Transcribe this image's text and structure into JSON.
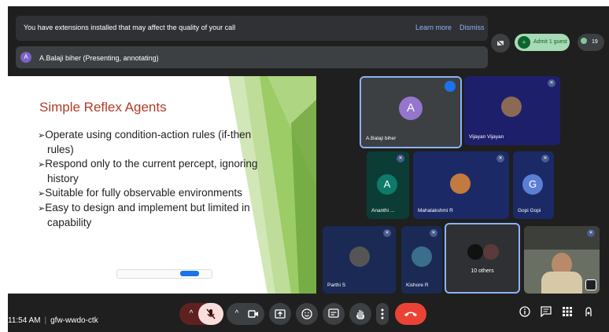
{
  "banner": {
    "message": "You have extensions installed that may affect the quality of your call",
    "learn_more": "Learn more",
    "dismiss": "Dismiss"
  },
  "presenter": {
    "initial": "A",
    "label": "A.Balaji biher (Presenting, annotating)"
  },
  "top_actions": {
    "admit_label": "Admit 1 guest",
    "people_count": "19"
  },
  "slide": {
    "title": "Simple Reflex Agents",
    "bullets": [
      "Operate using condition-action rules (if-then rules)",
      "Respond only to the current percept, ignoring history",
      "Suitable for fully observable environments",
      "Easy to design and implement but limited in capability"
    ],
    "bullet_marker": "➢"
  },
  "tiles": [
    {
      "name": "A.Balaji biher",
      "initial": "A",
      "bg": "#3c4043",
      "avatar": "#9575cd",
      "state": "speaking"
    },
    {
      "name": "Vijayan Vijayan",
      "bg": "#1e1f6b",
      "state": "muted"
    },
    {
      "name": "Ananthi ...",
      "initial": "A",
      "bg": "#0b3d36",
      "avatar": "#0e7a68",
      "state": "muted"
    },
    {
      "name": "Mahalakshmi R",
      "bg": "#1b2a66",
      "state": "muted"
    },
    {
      "name": "Gopi Gopi",
      "initial": "G",
      "bg": "#1b2a66",
      "avatar": "#5c7fd6",
      "state": "muted"
    },
    {
      "name": "Parthi S",
      "bg": "#1b2a55",
      "state": "muted"
    },
    {
      "name": "Kishore R",
      "bg": "#1b2a55",
      "state": "muted"
    },
    {
      "name": "10 others",
      "bg": "#2f3033",
      "state": "group"
    },
    {
      "name": "",
      "bg": "#6a6f63",
      "state": "video"
    }
  ],
  "bottom_bar": {
    "time": "11:54 AM",
    "meeting_code": "gfw-wwdo-ctk"
  },
  "icons": {
    "mic": "mic-off-icon",
    "camera": "camera-icon",
    "present": "present-icon",
    "emoji": "emoji-icon",
    "captions": "captions-icon",
    "hand": "raise-hand-icon",
    "more": "more-icon",
    "leave": "leave-call-icon",
    "info": "info-icon",
    "chat": "chat-icon",
    "activities": "activities-icon",
    "host": "host-controls-icon"
  },
  "colors": {
    "leave": "#ea4335",
    "admit_bg": "#a8dab5",
    "highlight_border": "#8ab4f8",
    "slide_title": "#b23a2a"
  }
}
